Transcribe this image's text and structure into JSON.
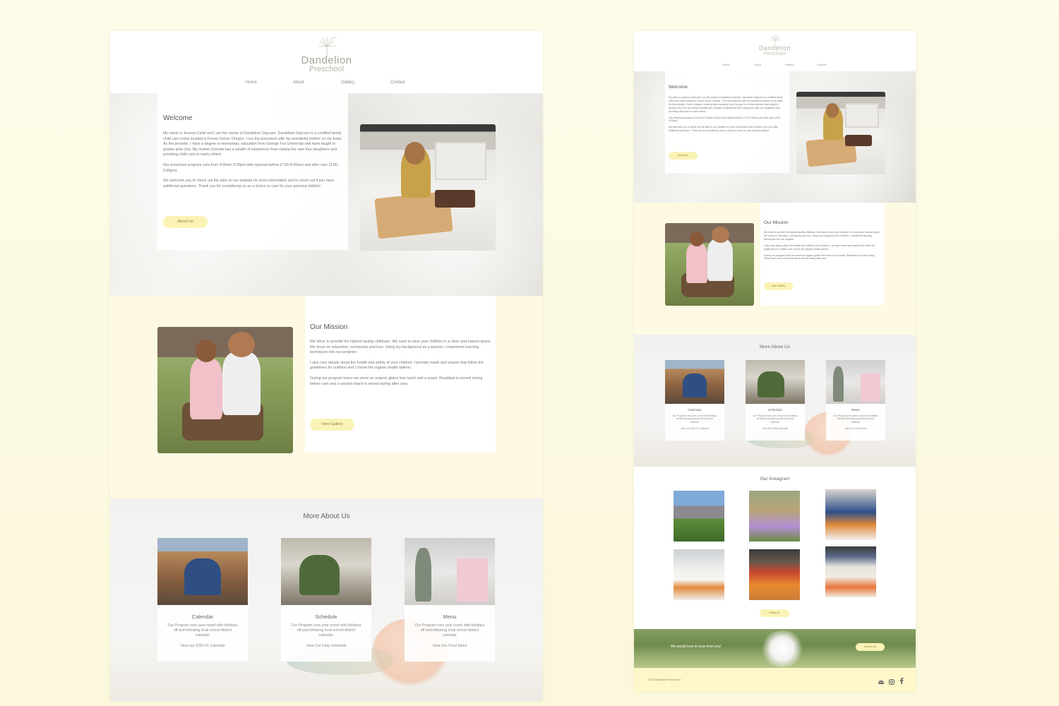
{
  "site": {
    "brand_name": "Dandelion",
    "brand_sub": "Preschool",
    "nav": [
      "Home",
      "About",
      "Gallery",
      "Contact"
    ]
  },
  "welcome": {
    "title": "Welcome",
    "p1": "My name is Jessica Cadd and I am the owner of Dandelion Daycare. Dandelion Daycare is a certified family child care home located in Forest Grove, Oregon. I run the preschool with my wonderful mother on my team. As the provider, I have a degree in elementary education from George Fox University and have taught in grades prek-2nd. My mother Donnita has a wealth of experience from raising her own four daughters and providing child care to many others.",
    "p2": "Our preschool program runs from 9:00am-3:00pm with optional before (7:00-9:00am) and after care (3:00-5:00pm).",
    "p3": "We welcome you to check out the tabs on our website for more information and to reach out if you have additional questions. Thank you for considering us as a choice to care for your precious kiddos!",
    "button": "About Us"
  },
  "mission": {
    "title": "Our Mission",
    "p1": "We strive to provide the highest quality childcare. We want to raise your children in a clean and natural space. We focus on education, community and love. Using my background as a teacher, I implement learning techniques into our program.",
    "p2": "I also care deeply about the health and safety of your children. I provide meals and snacks that follow the guidelines for nutrition and I chose the organic health options.",
    "p3": "During our program hours we serve an organic gluten free lunch and a snack. Breakfast is served during before care and a second snack is served during after care.",
    "button": "View Gallery"
  },
  "more": {
    "title": "More About Us",
    "cards": [
      {
        "title": "Calendar",
        "desc": "Our Program runs year round with holidays off and following local school district calendar.",
        "link": "View our 2020-21 Calendar"
      },
      {
        "title": "Schedule",
        "desc": "Our Program runs year round with holidays off and following local school district calendar.",
        "link": "View Our Daily Schedule"
      },
      {
        "title": "Menu",
        "desc": "Our Program runs year round with holidays off and following local school district calendar.",
        "link": "View Our Food Menu"
      }
    ]
  },
  "instagram": {
    "title": "Our Instagram",
    "button": "Follow Us"
  },
  "contact": {
    "text": "We would love to hear from you!",
    "button": "Contact Us"
  },
  "footer": {
    "copyright": "2020 Dandelion Preschool",
    "icons": [
      "mail-icon",
      "instagram-icon",
      "facebook-icon"
    ]
  },
  "colors": {
    "page_bg": "#fcf9e3",
    "accent_yellow": "#faf3b5",
    "section_yellow": "#fdf9e3",
    "footer_yellow": "#fdf7c9"
  }
}
